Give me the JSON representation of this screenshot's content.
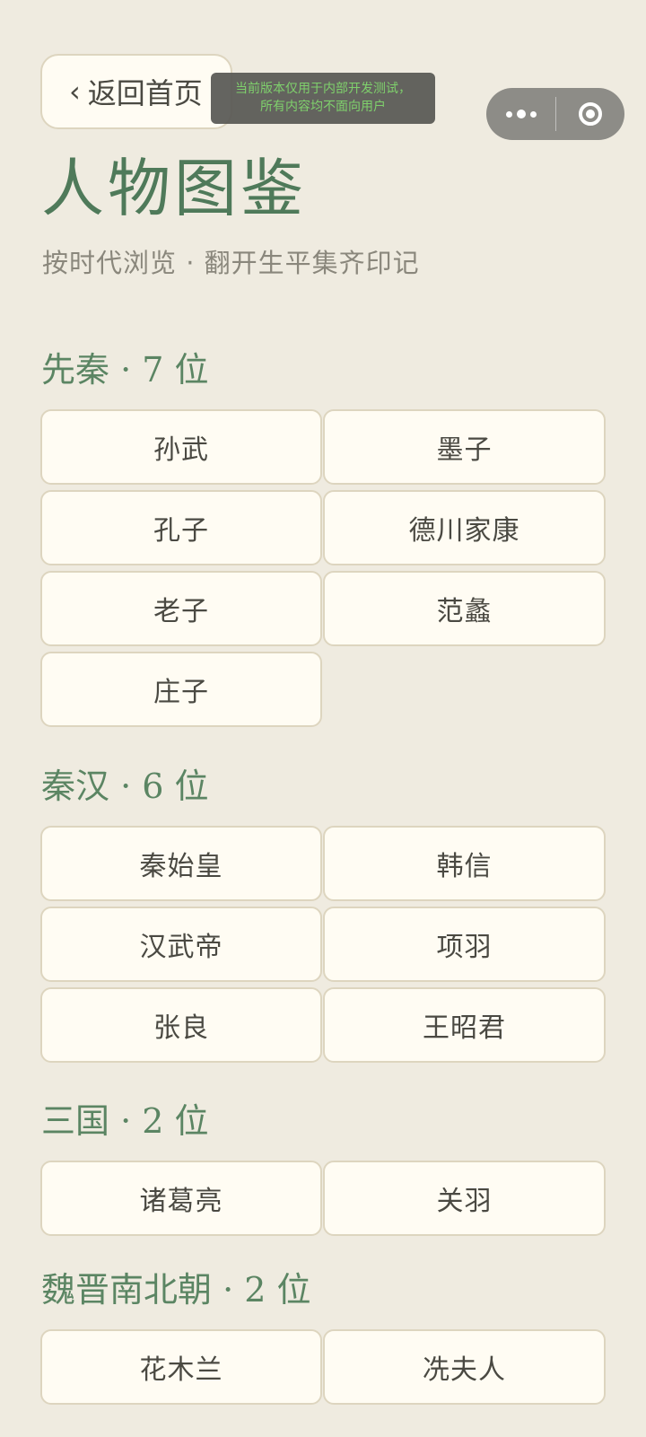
{
  "header": {
    "back_label": "返回首页",
    "back_chevron": "‹",
    "dev_notice_line1": "当前版本仅用于内部开发测试，",
    "dev_notice_line2": "所有内容均不面向用户"
  },
  "page": {
    "title": "人物图鉴",
    "subtitle": "按时代浏览 · 翻开生平集齐印记"
  },
  "sections": [
    {
      "title": "先秦 · 7 位",
      "people": [
        "孙武",
        "墨子",
        "孔子",
        "德川家康",
        "老子",
        "范蠡",
        "庄子"
      ]
    },
    {
      "title": "秦汉 · 6 位",
      "people": [
        "秦始皇",
        "韩信",
        "汉武帝",
        "项羽",
        "张良",
        "王昭君"
      ]
    },
    {
      "title": "三国 · 2 位",
      "people": [
        "诸葛亮",
        "关羽"
      ]
    },
    {
      "title": "魏晋南北朝 · 2 位",
      "people": [
        "花木兰",
        "冼夫人"
      ]
    }
  ],
  "colors": {
    "background": "#efebe0",
    "card_background": "#fffcf3",
    "card_border": "#ddd5bf",
    "accent_green": "#4f7a5a",
    "toast_text": "#7fd06c"
  },
  "icons": {
    "back": "chevron-left-icon",
    "capsule_more": "more-dots-icon",
    "capsule_close": "target-close-icon"
  }
}
